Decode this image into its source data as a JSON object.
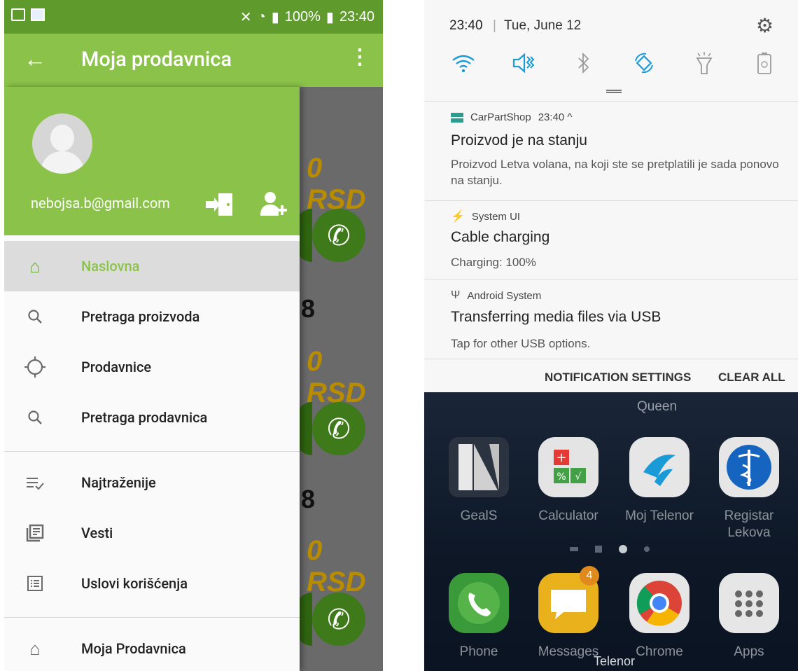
{
  "left_phone": {
    "status_bar": {
      "battery": "100%",
      "time": "23:40"
    },
    "app_bar": {
      "back_glyph": "←",
      "title": "Moja prodavnica",
      "more_glyph": "⋮"
    },
    "background": {
      "prices": [
        "0 RSD",
        "0 RSD",
        "0 RSD"
      ],
      "numbers": [
        "8",
        "8"
      ]
    },
    "drawer": {
      "email": "nebojsa.b@gmail.com",
      "items": [
        {
          "label": "Naslovna",
          "icon": "home-icon",
          "active": true
        },
        {
          "label": "Pretraga proizvoda",
          "icon": "search-icon"
        },
        {
          "label": "Prodavnice",
          "icon": "location-crosshair-icon"
        },
        {
          "label": "Pretraga prodavnica",
          "icon": "search-icon"
        }
      ],
      "items2": [
        {
          "label": "Najtraženije",
          "icon": "list-check-icon"
        },
        {
          "label": "Vesti",
          "icon": "news-icon"
        },
        {
          "label": "Uslovi korišćenja",
          "icon": "list-icon"
        }
      ],
      "items3": [
        {
          "label": "Moja Prodavnica",
          "icon": "home-icon"
        }
      ]
    }
  },
  "right_phone": {
    "quick_settings": {
      "time": "23:40",
      "separator": "|",
      "date": "Tue, June 12"
    },
    "notifications": [
      {
        "app": "CarPartShop",
        "time": "23:40 ^",
        "title": "Proizvod je na stanju",
        "text": "Proizvod Letva volana, na koji ste se pretplatili je sada ponovo na stanju."
      },
      {
        "app": "System UI",
        "title": "Cable charging",
        "text": "Charging: 100%"
      },
      {
        "app": "Android System",
        "title": "Transferring media files via USB",
        "text": "Tap for other USB options."
      }
    ],
    "actions": {
      "settings": "NOTIFICATION SETTINGS",
      "clear": "CLEAR ALL"
    },
    "home": {
      "partial_labels": [
        "Queen"
      ],
      "apps_row1": [
        "GealS",
        "Calculator",
        "Moj Telenor",
        "Registar Lekova"
      ],
      "apps_row2": [
        "Phone",
        "Messages",
        "Chrome",
        "Apps"
      ],
      "messages_badge": "4",
      "carrier": "Telenor"
    }
  }
}
